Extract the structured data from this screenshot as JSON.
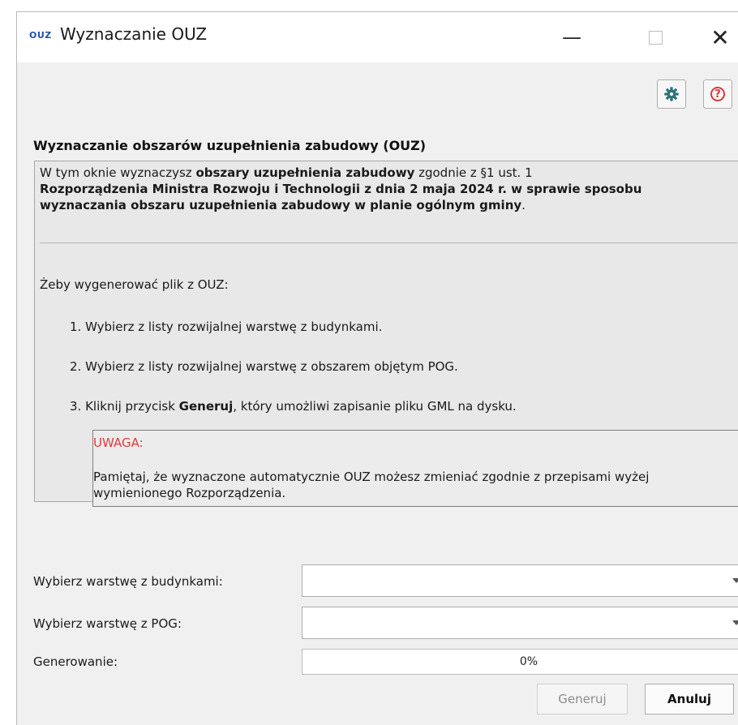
{
  "window": {
    "app_badge": "OUZ",
    "title": "Wyznaczanie OUZ",
    "minimize_glyph": "—",
    "close_glyph": "✕"
  },
  "toolbar": {
    "settings_icon": "gear-icon",
    "help_icon": "help-icon",
    "help_glyph": "?"
  },
  "heading": "Wyznaczanie obszarów uzupełnienia zabudowy (OUZ)",
  "info": {
    "intro_prefix": "W tym oknie wyznaczysz ",
    "intro_bold": "obszary uzupełnienia zabudowy",
    "intro_suffix": " zgodnie z §1 ust. 1",
    "regulation_line_1": "Rozporządzenia Ministra Rozwoju i Technologii z dnia 2 maja 2024 r. w sprawie sposobu",
    "regulation_line_2": "wyznaczania obszaru uzupełnienia zabudowy w planie ogólnym gminy",
    "regulation_end": ".",
    "lead": "Żeby wygenerować plik z OUZ:",
    "step1": "1. Wybierz z listy rozwijalnej warstwę z budynkami.",
    "step2": "2. Wybierz z listy rozwijalnej warstwę z obszarem objętym POG.",
    "step3_prefix": "3. Kliknij przycisk ",
    "step3_bold": "Generuj",
    "step3_suffix": ", który umożliwi zapisanie pliku GML na dysku.",
    "warning_title": "UWAGA:",
    "warning_line_1": "Pamiętaj, że wyznaczone automatycznie OUZ możesz zmieniać zgodnie z przepisami wyżej",
    "warning_line_2": "wymienionego Rozporządzenia."
  },
  "form": {
    "buildings_label": "Wybierz warstwę z budynkami:",
    "buildings_value": "",
    "pog_label": "Wybierz warstwę z POG:",
    "pog_value": "",
    "progress_label": "Generowanie:",
    "progress_text": "0%",
    "progress_fraction": 0
  },
  "buttons": {
    "generate": "Generuj",
    "cancel": "Anuluj"
  },
  "colors": {
    "warning": "#e23a3a",
    "help_icon": "#d23b3b",
    "settings_icon": "#2f7377"
  }
}
